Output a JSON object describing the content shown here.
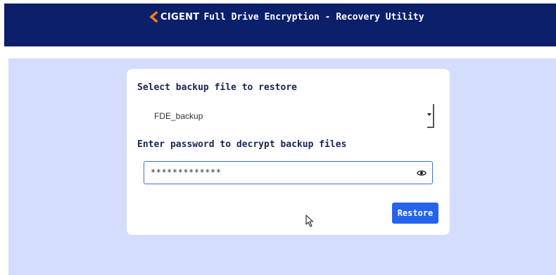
{
  "header": {
    "logo_text": "CIGENT",
    "title": "Full Drive Encryption - Recovery Utility"
  },
  "form": {
    "backup_label": "Select backup file to restore",
    "backup_selected": "FDE_backup",
    "password_label": "Enter password to decrypt backup files",
    "password_value": "*************",
    "restore_button": "Restore"
  },
  "colors": {
    "header_bg": "#0b1f6b",
    "content_bg": "#d4ddfb",
    "accent": "#2563eb",
    "logo_orange": "#f07c1a"
  }
}
